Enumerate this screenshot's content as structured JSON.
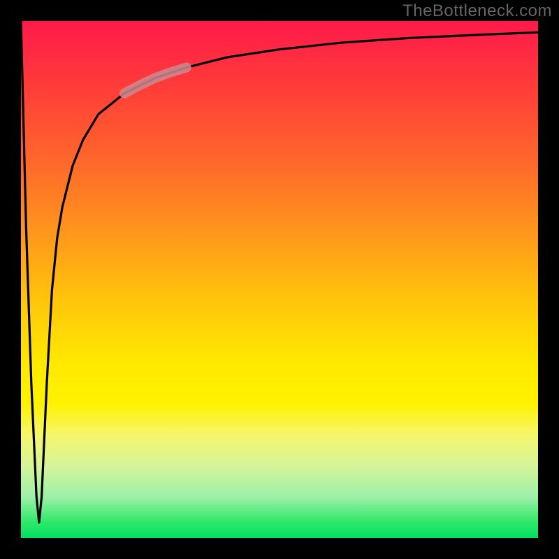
{
  "watermark": "TheBottleneck.com",
  "chart_data": {
    "type": "line",
    "title": "",
    "xlabel": "",
    "ylabel": "",
    "xlim": [
      0,
      100
    ],
    "ylim": [
      0,
      100
    ],
    "grid": false,
    "legend": false,
    "background_gradient": {
      "top": "#ff1a4a",
      "middle": "#ffe800",
      "bottom": "#00e060"
    },
    "series": [
      {
        "name": "bottleneck-curve",
        "color": "#000000",
        "x": [
          0,
          1,
          2,
          3,
          3.5,
          4,
          5,
          6,
          7,
          8,
          10,
          12,
          15,
          20,
          26,
          32,
          40,
          50,
          62,
          75,
          88,
          100
        ],
        "values": [
          100,
          60,
          30,
          8,
          3,
          8,
          30,
          48,
          58,
          64,
          72,
          77,
          82,
          86,
          89,
          91,
          93,
          94.5,
          95.8,
          96.7,
          97.3,
          97.8
        ]
      },
      {
        "name": "highlight-segment",
        "color": "#cc8a90",
        "x": [
          20,
          23,
          26,
          29,
          32
        ],
        "values": [
          86,
          87.6,
          89,
          90.1,
          91
        ]
      }
    ],
    "annotations": []
  }
}
